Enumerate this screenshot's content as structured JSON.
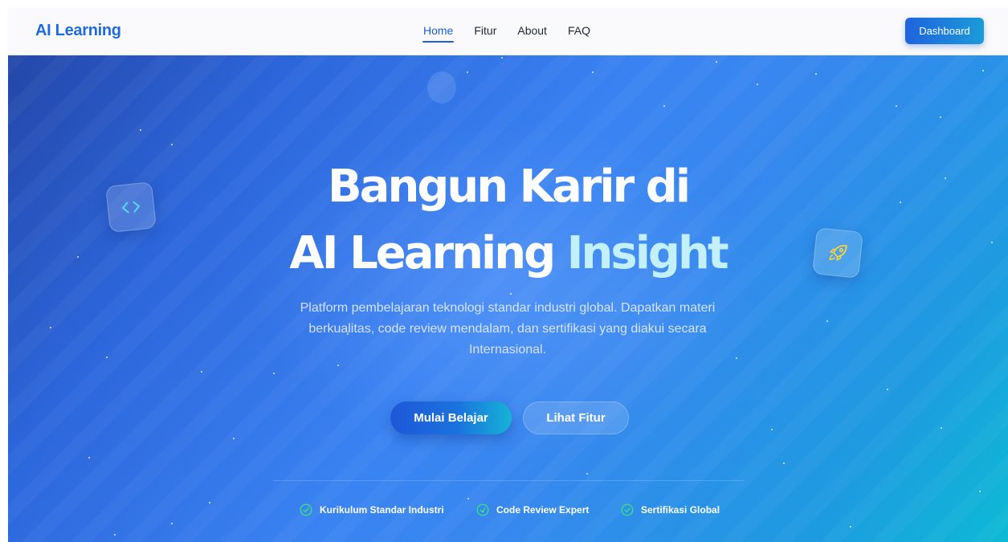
{
  "navbar": {
    "logo": "AI Learning",
    "links": [
      {
        "label": "Home",
        "active": true
      },
      {
        "label": "Fitur",
        "active": false
      },
      {
        "label": "About",
        "active": false
      },
      {
        "label": "FAQ",
        "active": false
      }
    ],
    "dashboard_label": "Dashboard"
  },
  "hero": {
    "title_line1": "Bangun Karir di",
    "title_line2_main": "AI Learning",
    "title_line2_accent": "Insight",
    "subtitle": "Platform pembelajaran teknologi standar industri global. Dapatkan materi berkualitas, code review mendalam, dan sertifikasi yang diakui secara Internasional.",
    "primary_cta": "Mulai Belajar",
    "secondary_cta": "Lihat Fitur",
    "features": [
      {
        "label": "Kurikulum Standar Industri",
        "icon": "check-circle-icon"
      },
      {
        "label": "Code Review Expert",
        "icon": "check-circle-icon"
      },
      {
        "label": "Sertifikasi Global",
        "icon": "check-circle-icon"
      }
    ],
    "floating_icons": [
      "code-icon",
      "rocket-icon"
    ]
  },
  "colors": {
    "brand": "#1e6be0",
    "accent_text": "#c2f1fb",
    "check_green": "#3ddc84",
    "rocket_yellow": "#f5d33c",
    "code_cyan": "#5ad8f5"
  }
}
